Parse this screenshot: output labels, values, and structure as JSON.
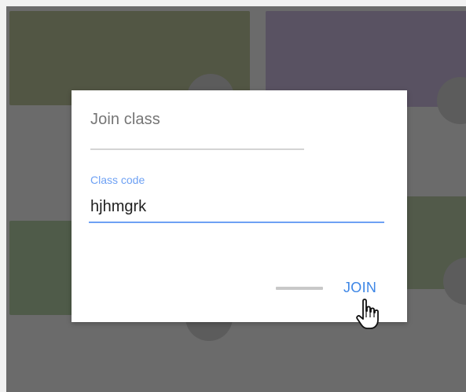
{
  "dialog": {
    "title": "Join class",
    "field_label": "Class code",
    "field_value": "hjhmgrk",
    "join_label": "JOIN"
  },
  "colors": {
    "accent": "#3d86e6",
    "field_focus": "#6ea1f4",
    "overlay": "#6b6b6b"
  },
  "icons": {
    "cursor": "hand-pointer-icon"
  }
}
